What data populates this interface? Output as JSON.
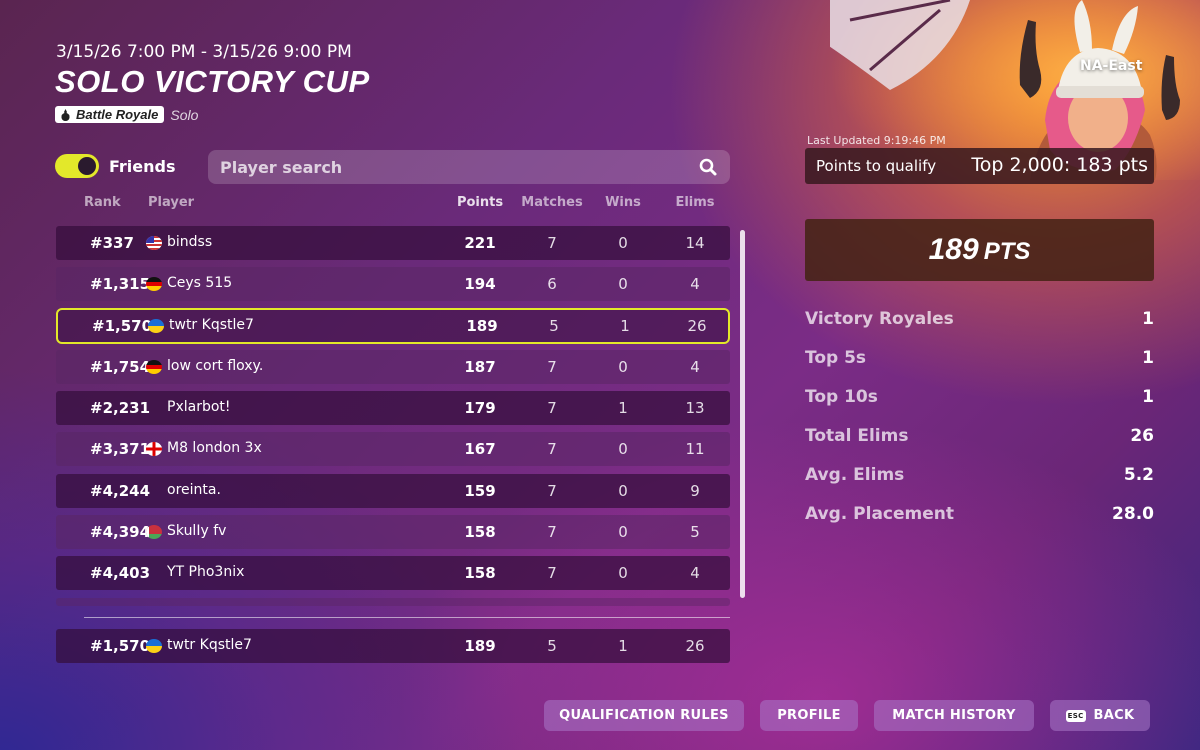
{
  "header": {
    "date_range": "3/15/26 7:00 PM - 3/15/26 9:00 PM",
    "title": "SOLO VICTORY CUP",
    "mode_chip": "Battle Royale",
    "mode_sub": "Solo"
  },
  "filters": {
    "friends_label": "Friends",
    "friends_on": true,
    "search_placeholder": "Player search"
  },
  "columns": {
    "rank": "Rank",
    "player": "Player",
    "points": "Points",
    "matches": "Matches",
    "wins": "Wins",
    "elims": "Elims"
  },
  "rows": [
    {
      "rank": "#337",
      "flag": "us",
      "player": "bindss",
      "points": "221",
      "matches": "7",
      "wins": "0",
      "elims": "14"
    },
    {
      "rank": "#1,315",
      "flag": "de",
      "player": "Ceys 515",
      "points": "194",
      "matches": "6",
      "wins": "0",
      "elims": "4"
    },
    {
      "rank": "#1,570",
      "flag": "ua",
      "player": "twtr Kqstle7",
      "points": "189",
      "matches": "5",
      "wins": "1",
      "elims": "26",
      "highlight": true
    },
    {
      "rank": "#1,754",
      "flag": "de",
      "player": "low cort floxy.",
      "points": "187",
      "matches": "7",
      "wins": "0",
      "elims": "4"
    },
    {
      "rank": "#2,231",
      "flag": "",
      "player": "Pxlarbot!",
      "points": "179",
      "matches": "7",
      "wins": "1",
      "elims": "13"
    },
    {
      "rank": "#3,371",
      "flag": "gb-eng",
      "player": "M8 london 3x",
      "points": "167",
      "matches": "7",
      "wins": "0",
      "elims": "11"
    },
    {
      "rank": "#4,244",
      "flag": "",
      "player": "oreinta.",
      "points": "159",
      "matches": "7",
      "wins": "0",
      "elims": "9"
    },
    {
      "rank": "#4,394",
      "flag": "by",
      "player": "SkulIy fv",
      "points": "158",
      "matches": "7",
      "wins": "0",
      "elims": "5"
    },
    {
      "rank": "#4,403",
      "flag": "",
      "player": "YT Pho3nix",
      "points": "158",
      "matches": "7",
      "wins": "0",
      "elims": "4"
    }
  ],
  "pinned_row": {
    "rank": "#1,570",
    "flag": "ua",
    "player": "twtr Kqstle7",
    "points": "189",
    "matches": "5",
    "wins": "1",
    "elims": "26"
  },
  "panel": {
    "region": "NA-East",
    "last_updated": "Last Updated 9:19:46 PM",
    "qualify_label": "Points to qualify",
    "qualify_value": "Top 2,000: 183 pts",
    "total_points": "189",
    "total_unit": "PTS",
    "stats": [
      {
        "label": "Victory Royales",
        "value": "1"
      },
      {
        "label": "Top 5s",
        "value": "1"
      },
      {
        "label": "Top 10s",
        "value": "1"
      },
      {
        "label": "Total Elims",
        "value": "26"
      },
      {
        "label": "Avg. Elims",
        "value": "5.2"
      },
      {
        "label": "Avg. Placement",
        "value": "28.0"
      }
    ]
  },
  "buttons": {
    "qualification_rules": "QUALIFICATION RULES",
    "profile": "PROFILE",
    "match_history": "MATCH HISTORY",
    "back": "BACK",
    "back_key": "ESC"
  },
  "colors": {
    "accent_yellow": "#e3e82a",
    "row_dark": "#340e3c",
    "panel_brown": "#46231a"
  }
}
